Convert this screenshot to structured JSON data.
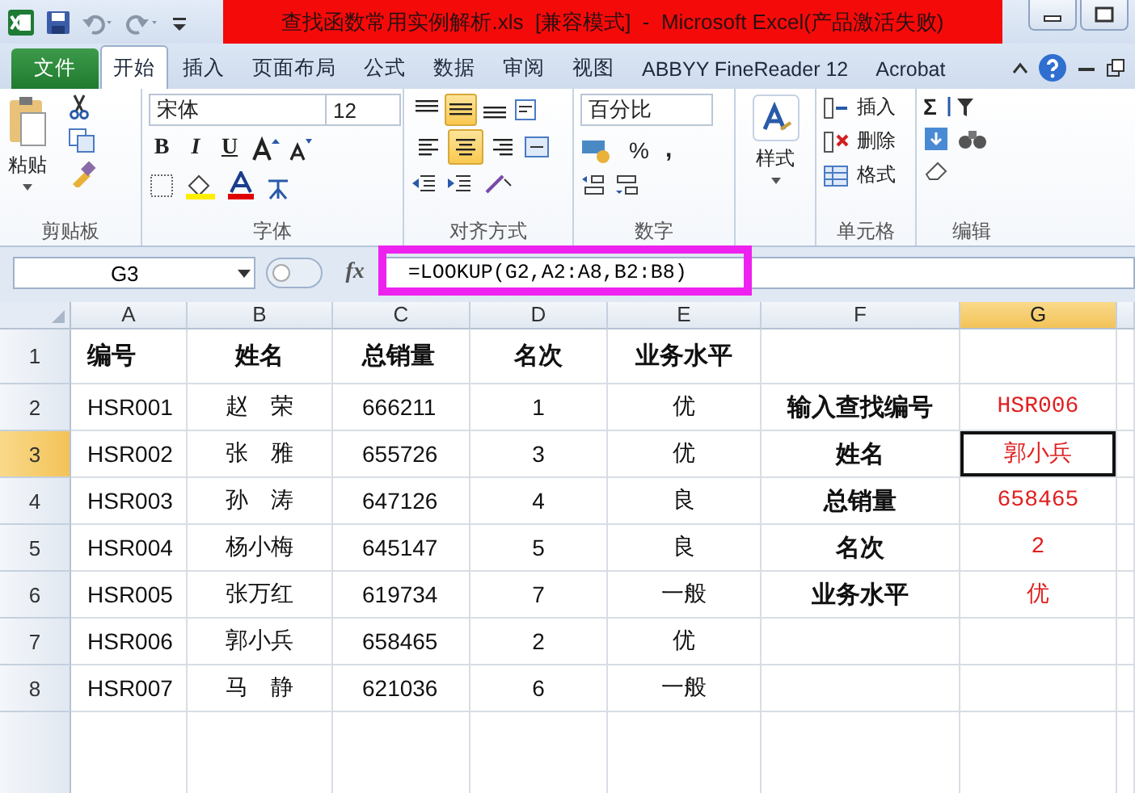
{
  "window": {
    "title": "查找函数常用实例解析.xls  [兼容模式]  -  Microsoft Excel(产品激活失败)"
  },
  "tabs": [
    {
      "label": "文件",
      "kind": "file",
      "selected": false
    },
    {
      "label": "开始",
      "kind": "tab",
      "selected": true
    },
    {
      "label": "插入",
      "kind": "tab",
      "selected": false
    },
    {
      "label": "页面布局",
      "kind": "tab",
      "selected": false
    },
    {
      "label": "公式",
      "kind": "tab",
      "selected": false
    },
    {
      "label": "数据",
      "kind": "tab",
      "selected": false
    },
    {
      "label": "审阅",
      "kind": "tab",
      "selected": false
    },
    {
      "label": "视图",
      "kind": "tab",
      "selected": false
    },
    {
      "label": "ABBYY FineReader 12",
      "kind": "tab",
      "selected": false
    },
    {
      "label": "Acrobat",
      "kind": "tab",
      "selected": false
    }
  ],
  "ribbon": {
    "clipboard": {
      "paste": "粘贴",
      "label": "剪贴板"
    },
    "font": {
      "font_name": "宋体",
      "font_size": "12",
      "buttons": [
        "B",
        "I",
        "U"
      ],
      "label": "字体"
    },
    "alignment": {
      "vertical": [
        {
          "kind": "top",
          "selected": false
        },
        {
          "kind": "middle",
          "selected": true
        },
        {
          "kind": "bottom",
          "selected": false
        }
      ],
      "horizontal": [
        {
          "kind": "left",
          "selected": false
        },
        {
          "kind": "center",
          "selected": true
        },
        {
          "kind": "right",
          "selected": false
        }
      ],
      "label": "对齐方式"
    },
    "number": {
      "format": "百分比",
      "percent": "%",
      "comma": ",",
      "label": "数字"
    },
    "styles": {
      "label": "样式"
    },
    "cells": {
      "insert": "插入",
      "delete": "删除",
      "format": "格式",
      "label": "单元格"
    },
    "editing": {
      "sum": "Σ",
      "label": "编辑"
    }
  },
  "formula_bar": {
    "name_box": "G3",
    "function_label": "fx",
    "formula": "=LOOKUP(G2,A2:A8,B2:B8)"
  },
  "sheet": {
    "columns": [
      {
        "label": "A",
        "selected": false
      },
      {
        "label": "B",
        "selected": false
      },
      {
        "label": "C",
        "selected": false
      },
      {
        "label": "D",
        "selected": false
      },
      {
        "label": "E",
        "selected": false
      },
      {
        "label": "F",
        "selected": false
      },
      {
        "label": "G",
        "selected": true
      }
    ],
    "rows": [
      {
        "number": "1",
        "selected": false,
        "kind": "header",
        "cells": [
          "编号",
          "姓名",
          "总销量",
          "名次",
          "业务水平"
        ]
      },
      {
        "number": "2",
        "selected": false,
        "kind": "data",
        "cells": [
          "HSR001",
          "赵　荣",
          "666211",
          "1",
          "优"
        ],
        "label": "输入查找编号",
        "value": {
          "text": "HSR006",
          "active": false
        }
      },
      {
        "number": "3",
        "selected": true,
        "kind": "data",
        "cells": [
          "HSR002",
          "张　雅",
          "655726",
          "3",
          "优"
        ],
        "label": "姓名",
        "value": {
          "text": "郭小兵",
          "active": true
        }
      },
      {
        "number": "4",
        "selected": false,
        "kind": "data",
        "cells": [
          "HSR003",
          "孙　涛",
          "647126",
          "4",
          "良"
        ],
        "label": "总销量",
        "value": {
          "text": "658465",
          "active": false
        }
      },
      {
        "number": "5",
        "selected": false,
        "kind": "data",
        "cells": [
          "HSR004",
          "杨小梅",
          "645147",
          "5",
          "良"
        ],
        "label": "名次",
        "value": {
          "text": "2",
          "active": false
        }
      },
      {
        "number": "6",
        "selected": false,
        "kind": "data",
        "cells": [
          "HSR005",
          "张万红",
          "619734",
          "7",
          "一般"
        ],
        "label": "业务水平",
        "value": {
          "text": "优",
          "active": false
        }
      },
      {
        "number": "7",
        "selected": false,
        "kind": "data",
        "cells": [
          "HSR006",
          "郭小兵",
          "658465",
          "2",
          "优"
        ]
      },
      {
        "number": "8",
        "selected": false,
        "kind": "data",
        "cells": [
          "HSR007",
          "马　静",
          "621036",
          "6",
          "一般"
        ]
      }
    ]
  }
}
